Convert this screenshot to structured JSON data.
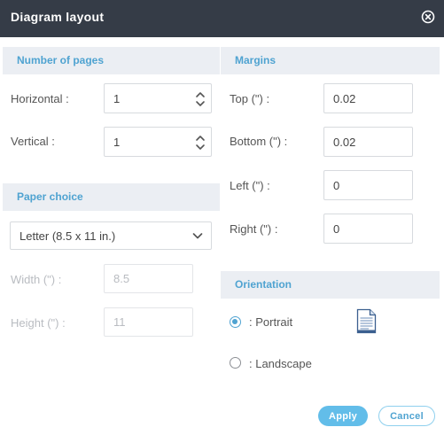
{
  "dialog": {
    "title": "Diagram layout",
    "close_icon": "close-circle-icon"
  },
  "number_of_pages": {
    "heading": "Number of pages",
    "horizontal_label": "Horizontal :",
    "horizontal_value": "1",
    "vertical_label": "Vertical :",
    "vertical_value": "1"
  },
  "paper_choice": {
    "heading": "Paper choice",
    "selected": "Letter (8.5 x 11 in.)",
    "width_label": "Width (\") :",
    "width_value": "8.5",
    "height_label": "Height (\") :",
    "height_value": "11"
  },
  "margins": {
    "heading": "Margins",
    "top_label": "Top (\") :",
    "top_value": "0.02",
    "bottom_label": "Bottom (\") :",
    "bottom_value": "0.02",
    "left_label": "Left (\") :",
    "left_value": "0",
    "right_label": "Right (\") :",
    "right_value": "0"
  },
  "orientation": {
    "heading": "Orientation",
    "portrait_label": ": Portrait",
    "landscape_label": ": Landscape",
    "selected": "portrait"
  },
  "buttons": {
    "apply": "Apply",
    "cancel": "Cancel"
  },
  "colors": {
    "titlebar": "#353c47",
    "section_bg": "#ebeef3",
    "accent": "#4fa3d1",
    "apply_bg": "#62bde9"
  }
}
